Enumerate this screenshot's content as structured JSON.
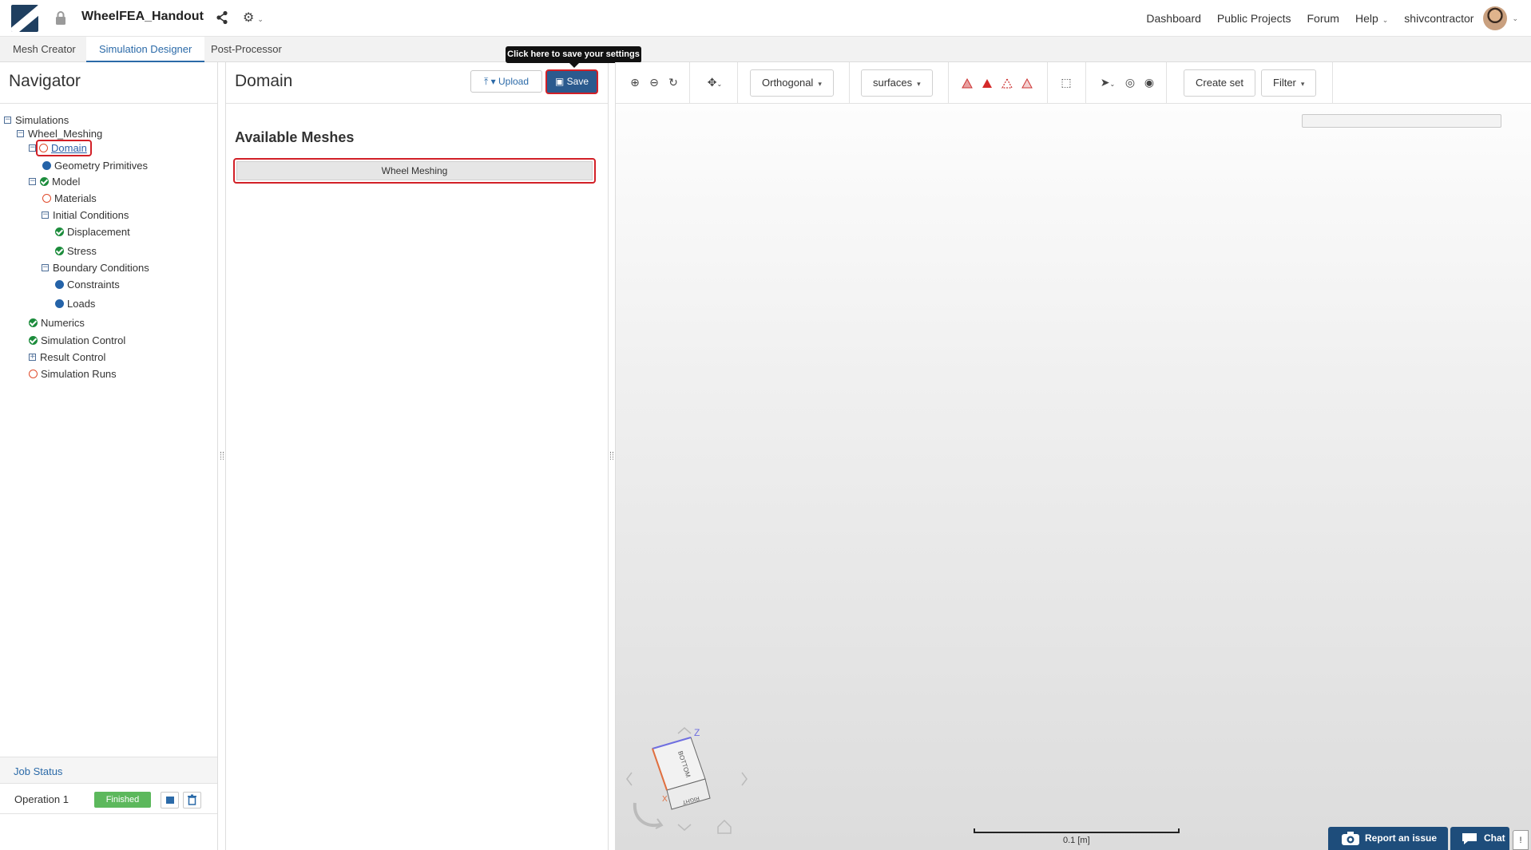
{
  "app": {
    "project_title": "WheelFEA_Handout",
    "topnav": {
      "dashboard": "Dashboard",
      "public_projects": "Public Projects",
      "forum": "Forum",
      "help": "Help",
      "username": "shivcontractor"
    }
  },
  "tabs": [
    {
      "label": "Mesh Creator",
      "active": false
    },
    {
      "label": "Simulation Designer",
      "active": true
    },
    {
      "label": "Post-Processor",
      "active": false
    }
  ],
  "navigator": {
    "title": "Navigator",
    "tree": {
      "simulations": "Simulations",
      "wheel_meshing": "Wheel_Meshing",
      "domain": "Domain",
      "geometry_primitives": "Geometry Primitives",
      "model": "Model",
      "materials": "Materials",
      "initial_conditions": "Initial Conditions",
      "displacement": "Displacement",
      "stress": "Stress",
      "boundary_conditions": "Boundary Conditions",
      "constraints": "Constraints",
      "loads": "Loads",
      "numerics": "Numerics",
      "simulation_control": "Simulation Control",
      "result_control": "Result Control",
      "simulation_runs": "Simulation Runs"
    },
    "job_status": {
      "title": "Job Status",
      "operation": "Operation 1",
      "status": "Finished"
    }
  },
  "domain_panel": {
    "title": "Domain",
    "upload_label": "Upload",
    "save_label": "Save",
    "save_tooltip": "Click here to save your settings",
    "available_meshes_title": "Available Meshes",
    "meshes": [
      "Wheel Meshing"
    ]
  },
  "viewer": {
    "projection": "Orthogonal",
    "render_mode": "surfaces",
    "create_set_label": "Create set",
    "filter_label": "Filter",
    "cube_faces": {
      "top": "BOTTOM",
      "front": "RIGHT"
    },
    "axis_labels": {
      "z": "Z",
      "x": "X"
    },
    "scale_label": "0.1 [m]"
  },
  "footer": {
    "report_label": "Report an issue",
    "chat_label": "Chat"
  },
  "colors": {
    "accent": "#2b6aa8",
    "highlight": "#d22027",
    "success": "#5cb85c",
    "status_green": "#1c8c3c",
    "status_blue": "#2563a8",
    "status_empty": "#e04c2c"
  }
}
